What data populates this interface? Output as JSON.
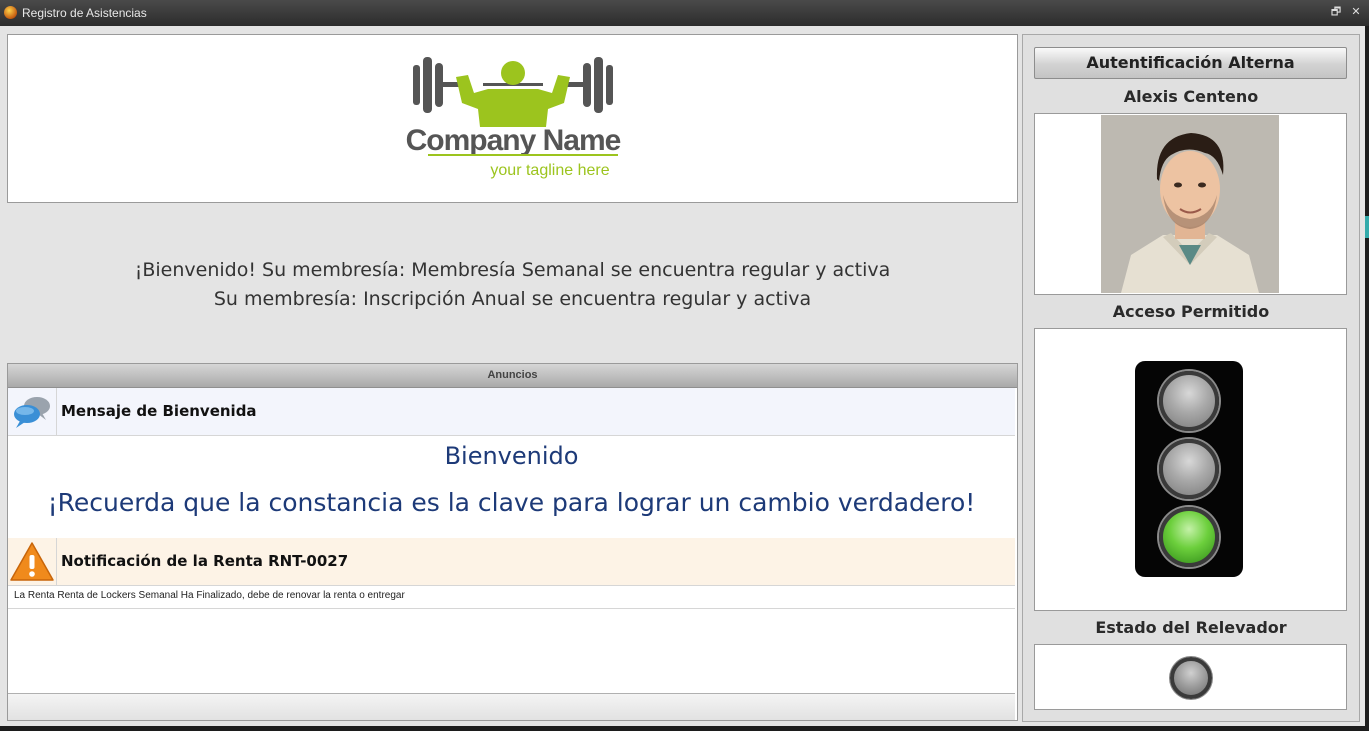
{
  "window": {
    "title": "Registro de Asistencias",
    "restore_glyph": "🗗",
    "close_glyph": "✕"
  },
  "logo": {
    "company": "Company Name",
    "tagline": "your tagline here",
    "brand_green": "#9cc41e",
    "brand_gray": "#555555"
  },
  "welcome": {
    "line1": "¡Bienvenido! Su membresía: Membresía Semanal se encuentra regular y activa",
    "line2": "Su membresía: Inscripción Anual se encuentra regular y activa"
  },
  "announcements": {
    "header": "Anuncios",
    "items": [
      {
        "icon": "chat-bubbles-icon",
        "title": "Mensaje de Bienvenida",
        "body_title": "Bienvenido",
        "body_text": "¡Recuerda que la constancia es la clave para lograr un cambio verdadero!"
      },
      {
        "icon": "warning-icon",
        "title": "Notificación de la Renta RNT-0027",
        "body_text": "La Renta Renta de Lockers Semanal Ha Finalizado, debe de renovar la renta o entregar"
      }
    ]
  },
  "side": {
    "alt_auth_label": "Autentificación Alterna",
    "member_name": "Alexis Centeno",
    "access_status": "Acceso Permitido",
    "traffic_light_active": "green",
    "relay_label": "Estado del Relevador",
    "relay_state": "off"
  }
}
